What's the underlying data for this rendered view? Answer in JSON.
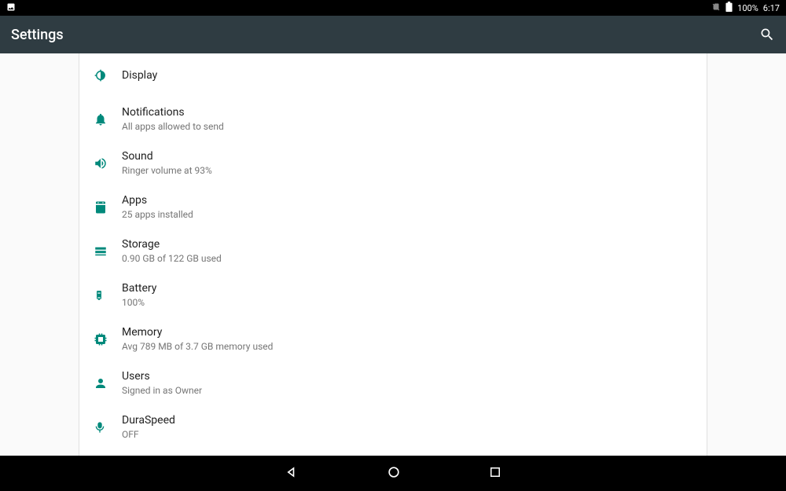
{
  "status": {
    "battery": "100%",
    "time": "6:17"
  },
  "app": {
    "title": "Settings"
  },
  "items": [
    {
      "icon": "display",
      "title": "Display",
      "sub": ""
    },
    {
      "icon": "notifications",
      "title": "Notifications",
      "sub": "All apps allowed to send"
    },
    {
      "icon": "sound",
      "title": "Sound",
      "sub": "Ringer volume at 93%"
    },
    {
      "icon": "apps",
      "title": "Apps",
      "sub": "25 apps installed"
    },
    {
      "icon": "storage",
      "title": "Storage",
      "sub": "0.90 GB of 122 GB used"
    },
    {
      "icon": "battery",
      "title": "Battery",
      "sub": "100%"
    },
    {
      "icon": "memory",
      "title": "Memory",
      "sub": "Avg 789 MB of 3.7 GB memory used"
    },
    {
      "icon": "users",
      "title": "Users",
      "sub": "Signed in as Owner"
    },
    {
      "icon": "duraspeed",
      "title": "DuraSpeed",
      "sub": "OFF"
    }
  ]
}
